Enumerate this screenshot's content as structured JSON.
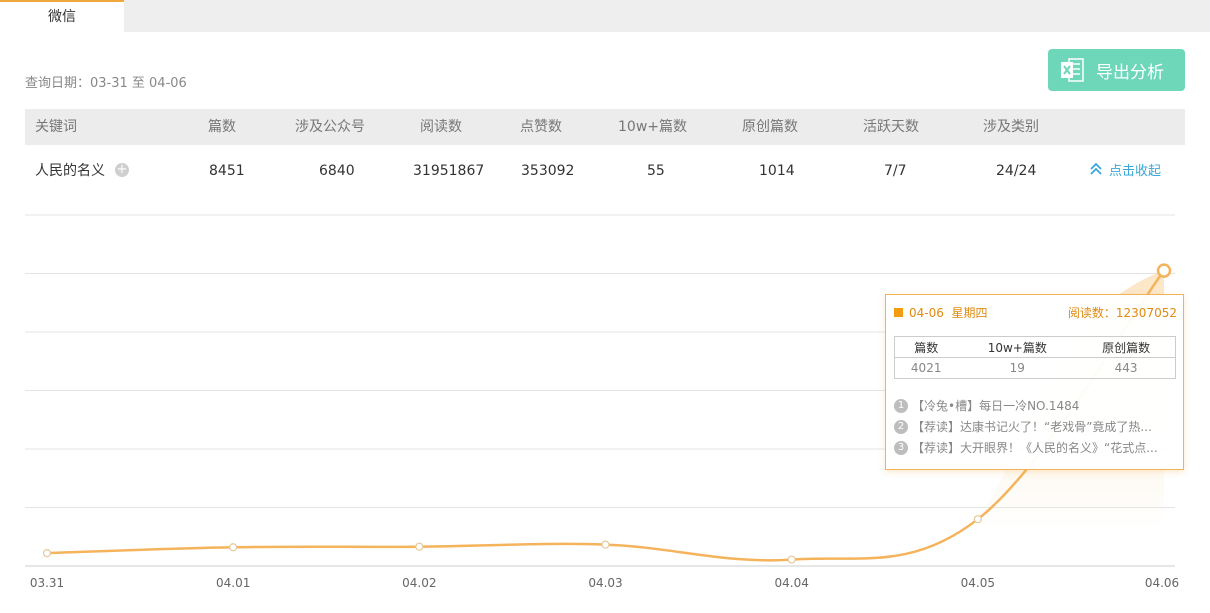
{
  "tab": {
    "label": "微信"
  },
  "query": {
    "text": "查询日期：03-31 至 04-06"
  },
  "export_button": {
    "label": "导出分析",
    "icon": "excel-icon",
    "color": "#6ed6b9"
  },
  "table": {
    "headers": [
      "关键词",
      "篇数",
      "涉及公众号",
      "阅读数",
      "点赞数",
      "10w+篇数",
      "原创篇数",
      "活跃天数",
      "涉及类别"
    ],
    "row": {
      "keyword": "人民的名义",
      "plus_icon": "+",
      "articles": "8451",
      "accounts": "6840",
      "reads": "31951867",
      "likes": "353092",
      "over_100k": "55",
      "original": "1014",
      "active_days": "7/7",
      "categories": "24/24",
      "collapse_label": "点击收起",
      "collapse_icon": "chevron-up-double-icon"
    }
  },
  "chart_data": {
    "type": "line",
    "x": [
      "03.31",
      "04.01",
      "04.02",
      "04.03",
      "04.04",
      "04.05",
      "04.06"
    ],
    "values": [
      2200000,
      3200000,
      3300000,
      3650000,
      1100000,
      8000000,
      50500000
    ],
    "line_color": "#f5b35c",
    "grid": true,
    "legend": "none"
  },
  "tooltip": {
    "date": "04-06",
    "weekday": "星期四",
    "read_text": "阅读数：12307052",
    "headers": [
      "篇数",
      "10w+篇数",
      "原创篇数"
    ],
    "values": [
      "4021",
      "19",
      "443"
    ],
    "articles": [
      {
        "num": "1",
        "title": "【冷兔•槽】每日一冷NO.1484"
      },
      {
        "num": "2",
        "title": "【荐读】达康书记火了！“老戏骨”竟成了热..."
      },
      {
        "num": "3",
        "title": "【荐读】大开眼界！《人民的名义》“花式点..."
      }
    ]
  }
}
